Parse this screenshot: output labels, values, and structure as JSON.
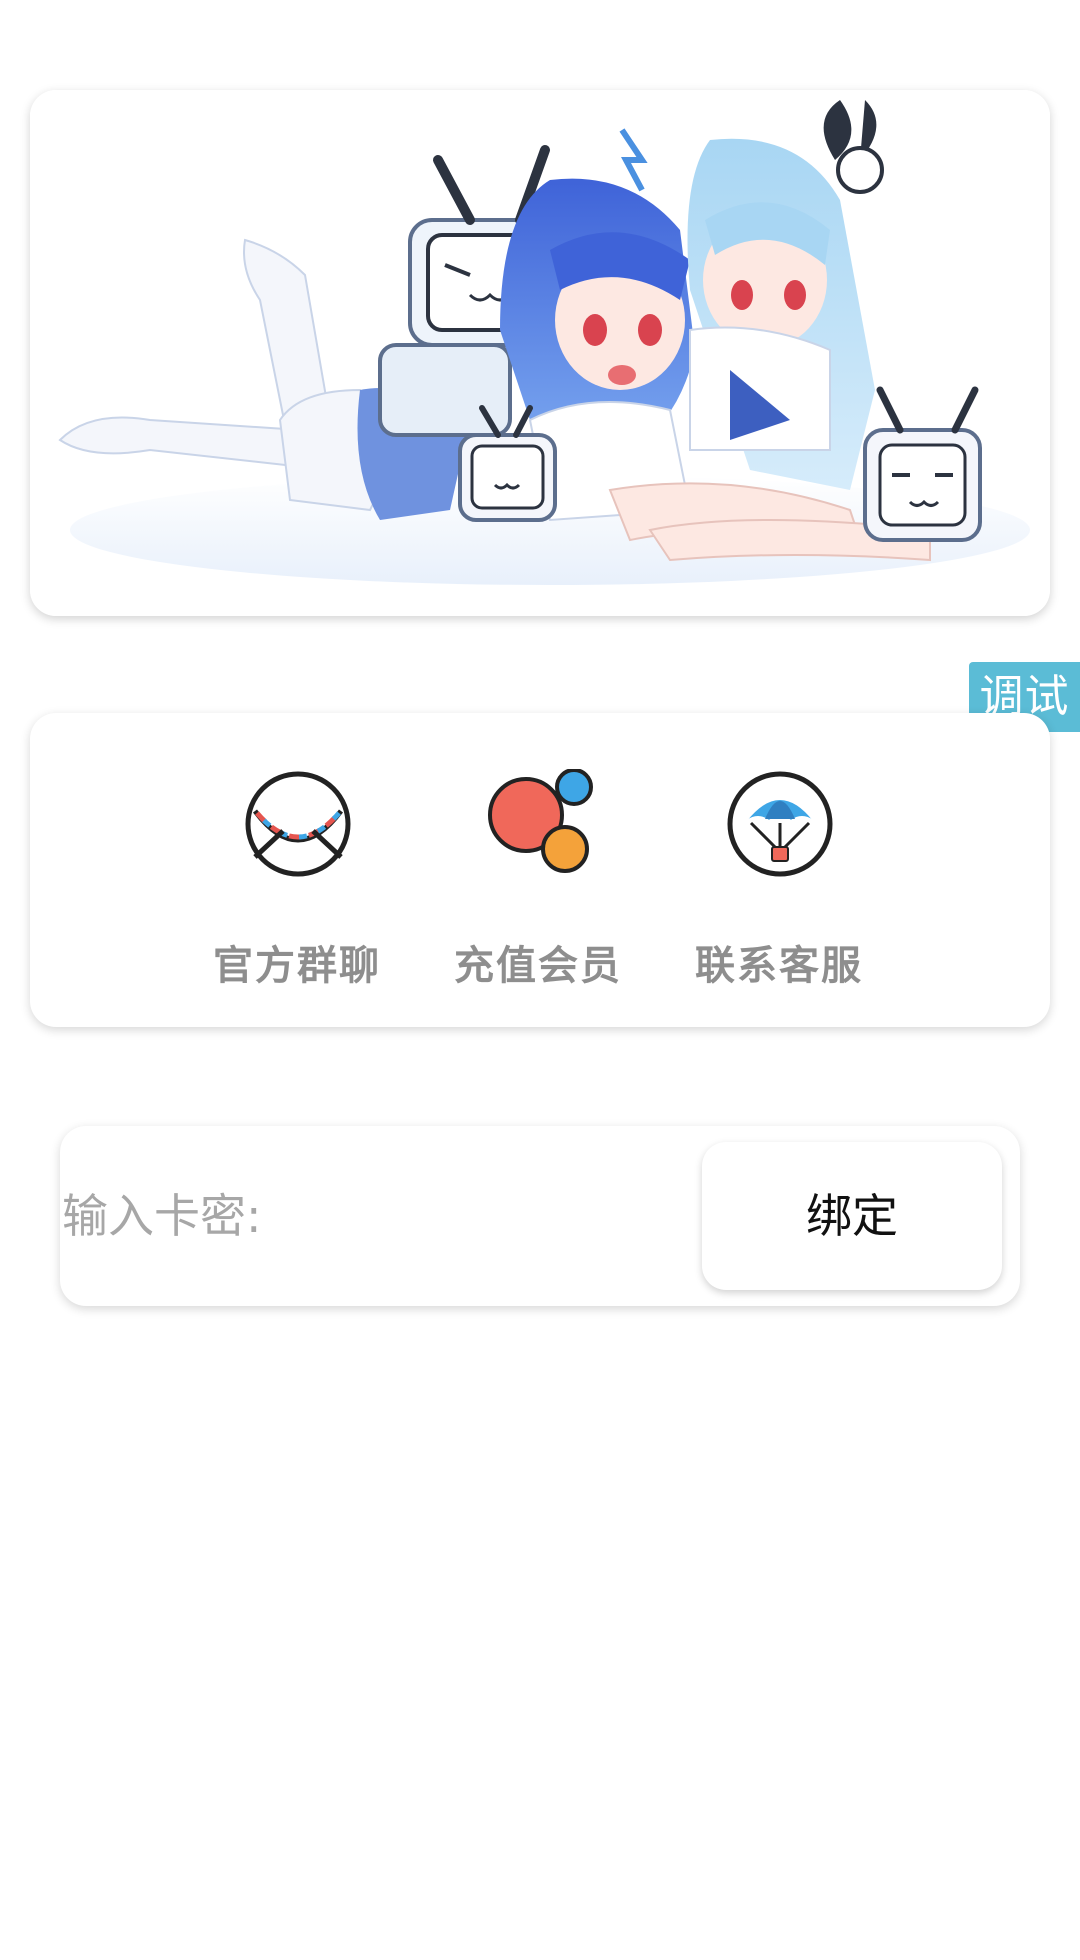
{
  "banner": {
    "image_name": "anime-characters-banner"
  },
  "debug": {
    "label": "调试"
  },
  "menu": {
    "items": [
      {
        "label": "官方群聊",
        "icon": "chat-bubble-icon"
      },
      {
        "label": "充值会员",
        "icon": "bubbles-icon"
      },
      {
        "label": "联系客服",
        "icon": "parachute-icon"
      }
    ]
  },
  "bind": {
    "placeholder": "输入卡密:",
    "button_label": "绑定"
  },
  "colors": {
    "debug_bg": "#5bbcd6",
    "label_gray": "#8e8e8e"
  }
}
